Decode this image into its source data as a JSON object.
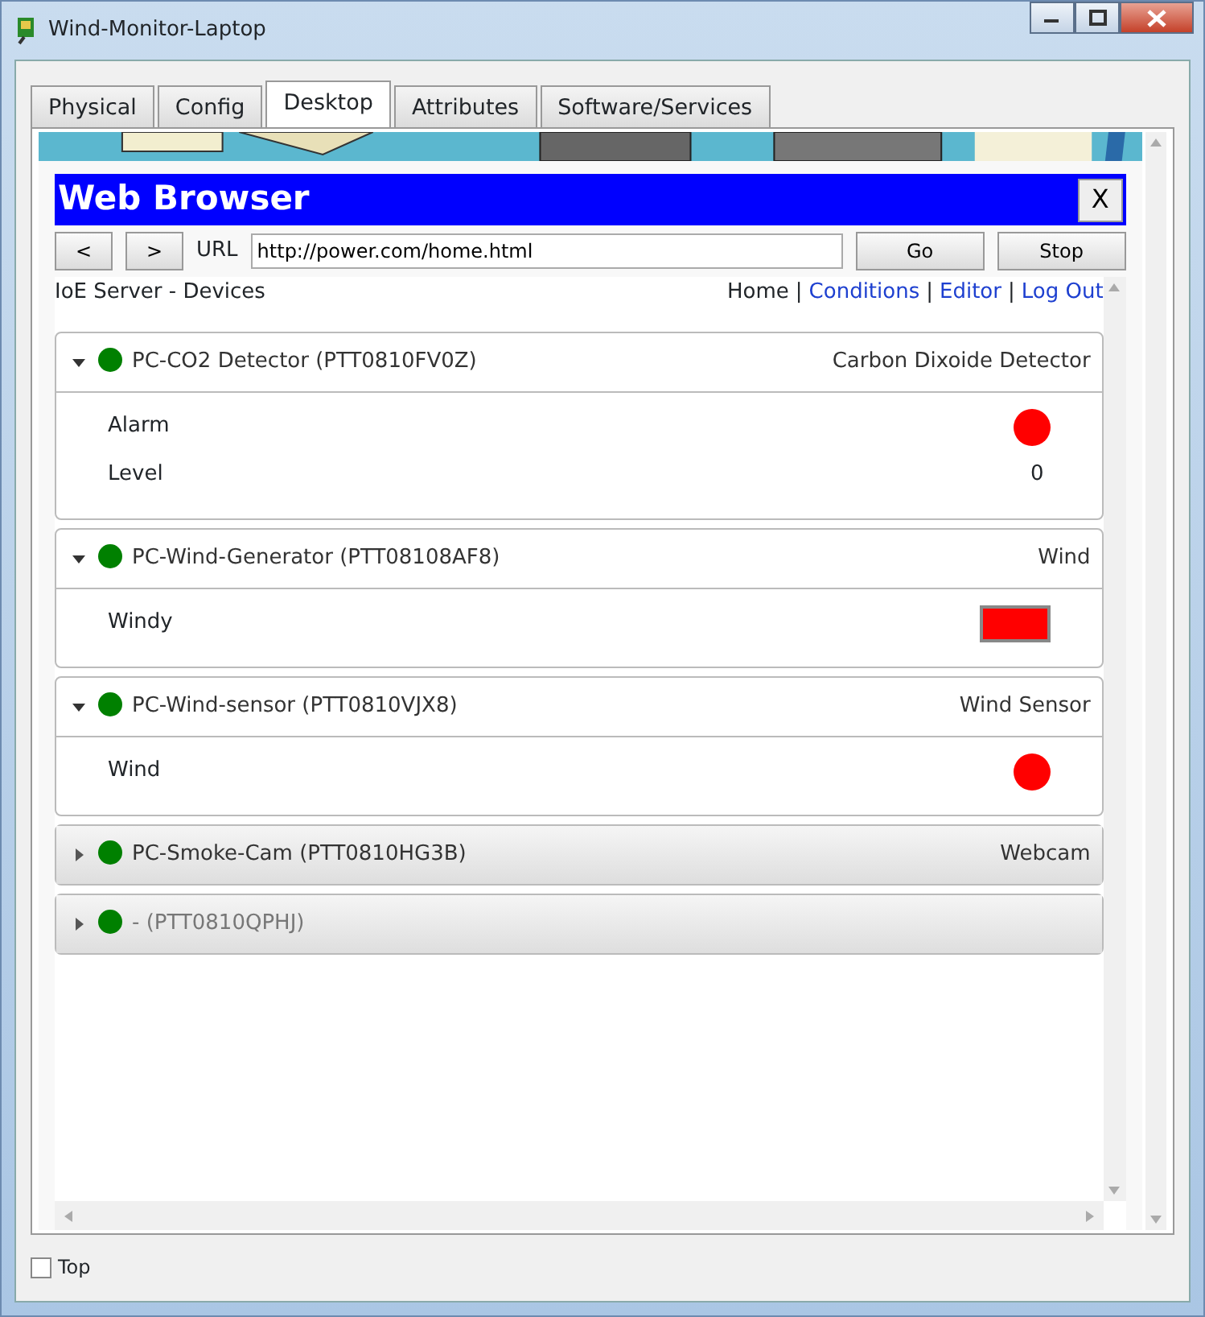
{
  "window": {
    "title": "Wind-Monitor-Laptop"
  },
  "tabs": [
    {
      "label": "Physical",
      "selected": false
    },
    {
      "label": "Config",
      "selected": false
    },
    {
      "label": "Desktop",
      "selected": true
    },
    {
      "label": "Attributes",
      "selected": false
    },
    {
      "label": "Software/Services",
      "selected": false
    }
  ],
  "browser": {
    "title": "Web Browser",
    "close": "X",
    "back": "<",
    "forward": ">",
    "url_label": "URL",
    "url": "http://power.com/home.html",
    "go": "Go",
    "stop": "Stop"
  },
  "page": {
    "heading": "IoE Server - Devices",
    "nav": [
      {
        "label": "Home",
        "link": false
      },
      {
        "label": "Conditions",
        "link": true
      },
      {
        "label": "Editor",
        "link": true
      },
      {
        "label": "Log Out",
        "link": true
      }
    ],
    "separator": "|",
    "devices": [
      {
        "name": "PC-CO2 Detector (PTT0810FV0Z)",
        "type": "Carbon Dixoide Detector",
        "expanded": true,
        "disabled": false,
        "rows": [
          {
            "label": "Alarm",
            "kind": "dot",
            "color": "#ff0000"
          },
          {
            "label": "Level",
            "kind": "value",
            "value": "0"
          }
        ]
      },
      {
        "name": "PC-Wind-Generator (PTT08108AF8)",
        "type": "Wind",
        "expanded": true,
        "disabled": false,
        "rows": [
          {
            "label": "Windy",
            "kind": "swatch",
            "color": "#ff0000"
          }
        ]
      },
      {
        "name": "PC-Wind-sensor (PTT0810VJX8)",
        "type": "Wind Sensor",
        "expanded": true,
        "disabled": false,
        "rows": [
          {
            "label": "Wind",
            "kind": "dot",
            "color": "#ff0000"
          }
        ]
      },
      {
        "name": "PC-Smoke-Cam (PTT0810HG3B)",
        "type": "Webcam",
        "expanded": false,
        "disabled": false
      },
      {
        "name": "- (PTT0810QPHJ)",
        "expanded": false,
        "disabled": true
      }
    ]
  },
  "top_checkbox": {
    "label": "Top",
    "checked": false
  }
}
